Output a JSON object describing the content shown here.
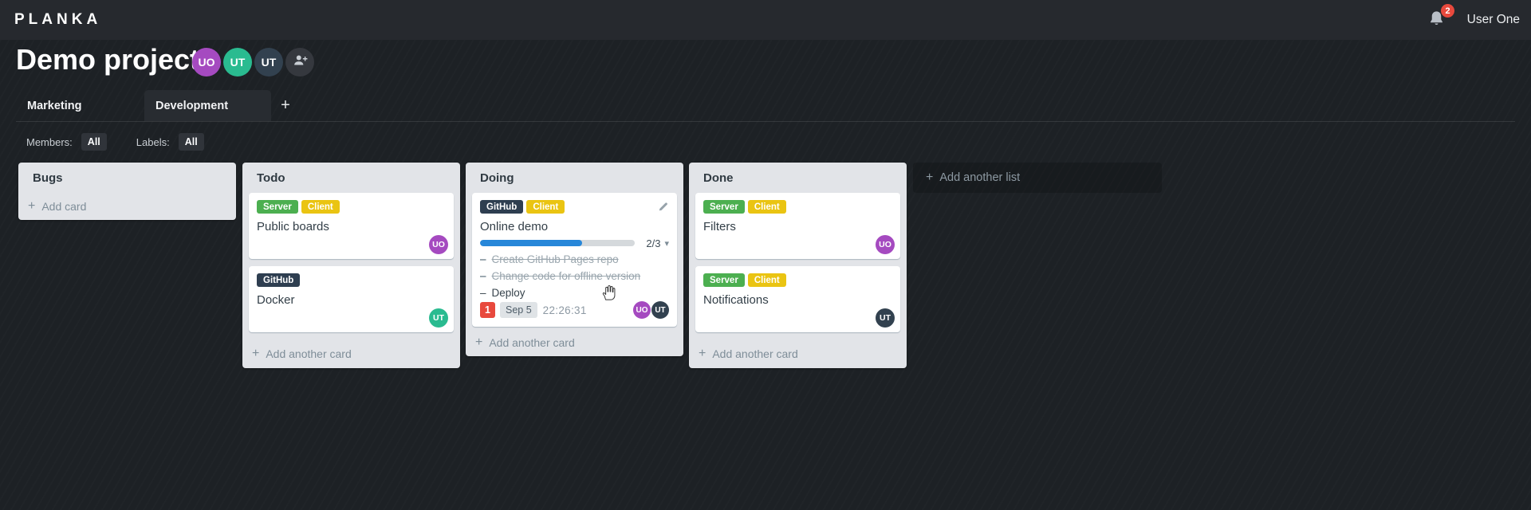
{
  "colors": {
    "notification_red": "#e8493d",
    "progress_blue": "#2787d9"
  },
  "icons": {
    "plus": "+",
    "caret_down": "▾",
    "dash": "–"
  },
  "header": {
    "logo": "PLANKA",
    "notification_count": "2",
    "user_name": "User One"
  },
  "project": {
    "title": "Demo project",
    "members": [
      {
        "initials": "UO",
        "color": "#a54ac0"
      },
      {
        "initials": "UT",
        "color": "#2abb90"
      },
      {
        "initials": "UT",
        "color": "#32414f"
      }
    ]
  },
  "tabs": {
    "items": [
      {
        "label": "Marketing"
      },
      {
        "label": "Development"
      }
    ]
  },
  "filter_bar": {
    "members_label": "Members:",
    "members_value": "All",
    "labels_label": "Labels:",
    "labels_value": "All"
  },
  "board": {
    "add_list_label": "Add another list",
    "lists": [
      {
        "title": "Bugs",
        "add_card_label": "Add card",
        "cards": []
      },
      {
        "title": "Todo",
        "add_card_label": "Add another card",
        "cards": [
          {
            "title": "Public boards",
            "labels": [
              {
                "text": "Server",
                "color": "#4caf50"
              },
              {
                "text": "Client",
                "color": "#eac412"
              }
            ],
            "members": [
              {
                "initials": "UO",
                "color": "#a54ac0"
              }
            ]
          },
          {
            "title": "Docker",
            "labels": [
              {
                "text": "GitHub",
                "color": "#2e3e50"
              }
            ],
            "members": [
              {
                "initials": "UT",
                "color": "#2abb90"
              }
            ]
          }
        ]
      },
      {
        "title": "Doing",
        "add_card_label": "Add another card",
        "cards": [
          {
            "title": "Online demo",
            "labels": [
              {
                "text": "GitHub",
                "color": "#2e3e50"
              },
              {
                "text": "Client",
                "color": "#eac412"
              }
            ],
            "progress": {
              "done": 2,
              "total": 3,
              "label": "2/3",
              "fill": "66%"
            },
            "tasks": [
              {
                "text": "Create GitHub Pages repo",
                "completed": true
              },
              {
                "text": "Change code for offline version",
                "completed": true
              },
              {
                "text": "Deploy",
                "completed": false
              }
            ],
            "notification_count": "1",
            "due_date": "Sep 5",
            "timer": "22:26:31",
            "members": [
              {
                "initials": "UO",
                "color": "#a54ac0"
              },
              {
                "initials": "UT",
                "color": "#32414f"
              }
            ]
          }
        ]
      },
      {
        "title": "Done",
        "add_card_label": "Add another card",
        "cards": [
          {
            "title": "Filters",
            "labels": [
              {
                "text": "Server",
                "color": "#4caf50"
              },
              {
                "text": "Client",
                "color": "#eac412"
              }
            ],
            "members": [
              {
                "initials": "UO",
                "color": "#a54ac0"
              }
            ]
          },
          {
            "title": "Notifications",
            "labels": [
              {
                "text": "Server",
                "color": "#4caf50"
              },
              {
                "text": "Client",
                "color": "#eac412"
              }
            ],
            "members": [
              {
                "initials": "UT",
                "color": "#32414f"
              }
            ]
          }
        ]
      }
    ]
  }
}
